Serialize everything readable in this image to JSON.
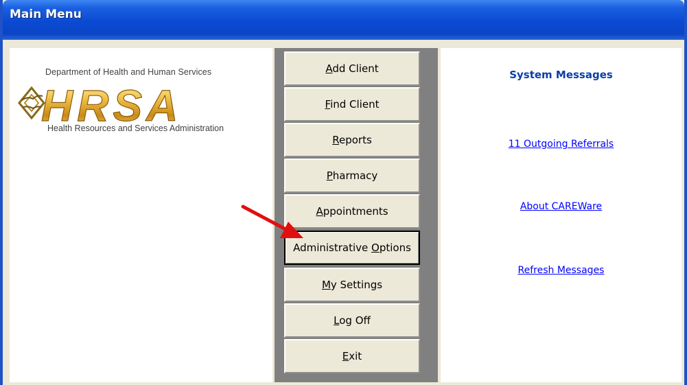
{
  "window": {
    "title": "Main Menu"
  },
  "branding": {
    "department": "Department of Health and Human Services",
    "logo_text": "HRSA",
    "administration": "Health Resources and Services Administration"
  },
  "menu": {
    "items": [
      {
        "label": "Add Client",
        "mnemonic": "A"
      },
      {
        "label": "Find Client",
        "mnemonic": "F"
      },
      {
        "label": "Reports",
        "mnemonic": "R"
      },
      {
        "label": "Pharmacy",
        "mnemonic": "P"
      },
      {
        "label": "Appointments",
        "mnemonic": "A"
      },
      {
        "label": "Administrative Options",
        "mnemonic": "O"
      },
      {
        "label": "My Settings",
        "mnemonic": "M"
      },
      {
        "label": "Log Off",
        "mnemonic": "L"
      },
      {
        "label": "Exit",
        "mnemonic": "E"
      }
    ],
    "focused_index": 5
  },
  "messages": {
    "title": "System Messages",
    "links": [
      {
        "label": "11  Outgoing Referrals"
      },
      {
        "label": "About CAREWare"
      },
      {
        "label": "Refresh Messages"
      }
    ]
  },
  "colors": {
    "title_bar": "#0a4ad3",
    "menu_face": "#ece9d8",
    "link": "#0000ff",
    "heading": "#0a3fa8",
    "annotation_arrow": "#e01010"
  },
  "icons": {
    "logo_emblem": "hhs-eagle-emblem-icon",
    "annotation": "red-arrow-icon"
  }
}
